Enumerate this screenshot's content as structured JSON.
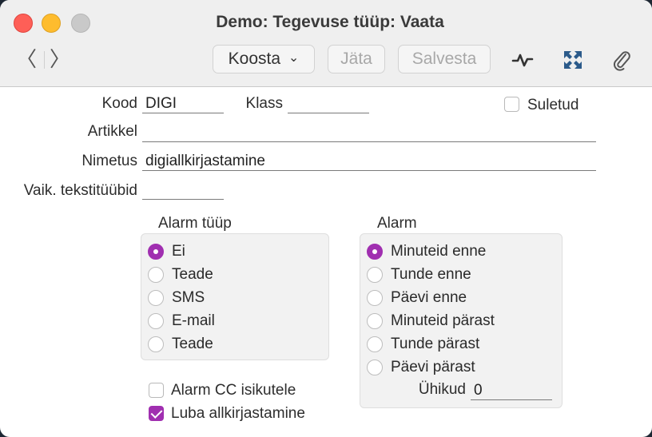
{
  "window": {
    "title": "Demo: Tegevuse tüüp: Vaata"
  },
  "toolbar": {
    "back_glyph": "〈",
    "forward_glyph": "〉",
    "compose_label": "Koosta",
    "compose_chevron": "⌄",
    "skip_label": "Jäta",
    "save_label": "Salvesta",
    "icons": [
      "activity-icon",
      "expand-icon",
      "paperclip-icon"
    ]
  },
  "form": {
    "kood_label": "Kood",
    "kood_value": "DIGI",
    "klass_label": "Klass",
    "klass_value": "",
    "suletud_label": "Suletud",
    "suletud_checked": false,
    "artikkel_label": "Artikkel",
    "artikkel_value": "",
    "nimetus_label": "Nimetus",
    "nimetus_value": "digiallkirjastamine",
    "vaik_label": "Vaik. tekstitüübid",
    "vaik_value": ""
  },
  "alarm_type": {
    "title": "Alarm tüüp",
    "options": [
      "Ei",
      "Teade",
      "SMS",
      "E-mail",
      "Teade"
    ],
    "selected": 0
  },
  "alarm": {
    "title": "Alarm",
    "options": [
      "Minuteid enne",
      "Tunde enne",
      "Päevi enne",
      "Minuteid pärast",
      "Tunde pärast",
      "Päevi pärast"
    ],
    "selected": 0,
    "units_label": "Ühikud",
    "units_value": "0"
  },
  "checks": {
    "cc_label": "Alarm CC isikutele",
    "cc_checked": false,
    "sign_label": "Luba allkirjastamine",
    "sign_checked": true
  },
  "colors": {
    "accent": "#a02fb0",
    "close": "#fe5f57",
    "minimize": "#febc2e"
  }
}
